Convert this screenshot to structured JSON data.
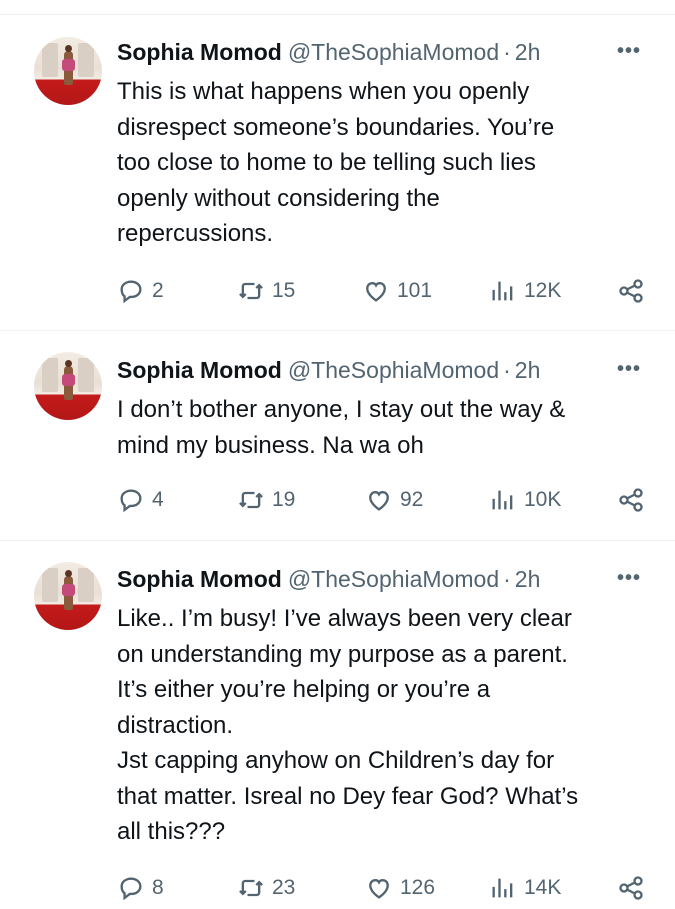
{
  "tweets": [
    {
      "author": "Sophia Momod",
      "handle": "@TheSophiaMomod",
      "separator": "·",
      "time": "2h",
      "more": "•••",
      "text": "This is what happens when you openly\ndisrespect someone’s boundaries. You’re\ntoo close to home to be telling such lies\nopenly without considering the\nrepercussions.",
      "replies": "2",
      "retweets": "15",
      "likes": "101",
      "views": "12K"
    },
    {
      "author": "Sophia Momod",
      "handle": "@TheSophiaMomod",
      "separator": "·",
      "time": "2h",
      "more": "•••",
      "text": "I don’t bother anyone, I stay out the way &\nmind my business. Na wa oh",
      "replies": "4",
      "retweets": "19",
      "likes": "92",
      "views": "10K"
    },
    {
      "author": "Sophia Momod",
      "handle": "@TheSophiaMomod",
      "separator": "·",
      "time": "2h",
      "more": "•••",
      "text": "Like.. I’m busy! I’ve always been very clear\non understanding my purpose as a parent.\nIt’s either you’re helping or you’re a\ndistraction.\nJst capping anyhow on Children’s day for\nthat matter. Isreal no Dey fear God? What’s\nall this???",
      "replies": "8",
      "retweets": "23",
      "likes": "126",
      "views": "14K"
    }
  ],
  "icons": {
    "reply": "reply-icon",
    "retweet": "retweet-icon",
    "like": "heart-icon",
    "views": "views-icon",
    "share": "share-icon",
    "more": "more-icon"
  },
  "colors": {
    "text": "#0f1419",
    "secondary": "#536471",
    "divider": "#eff3f4"
  }
}
